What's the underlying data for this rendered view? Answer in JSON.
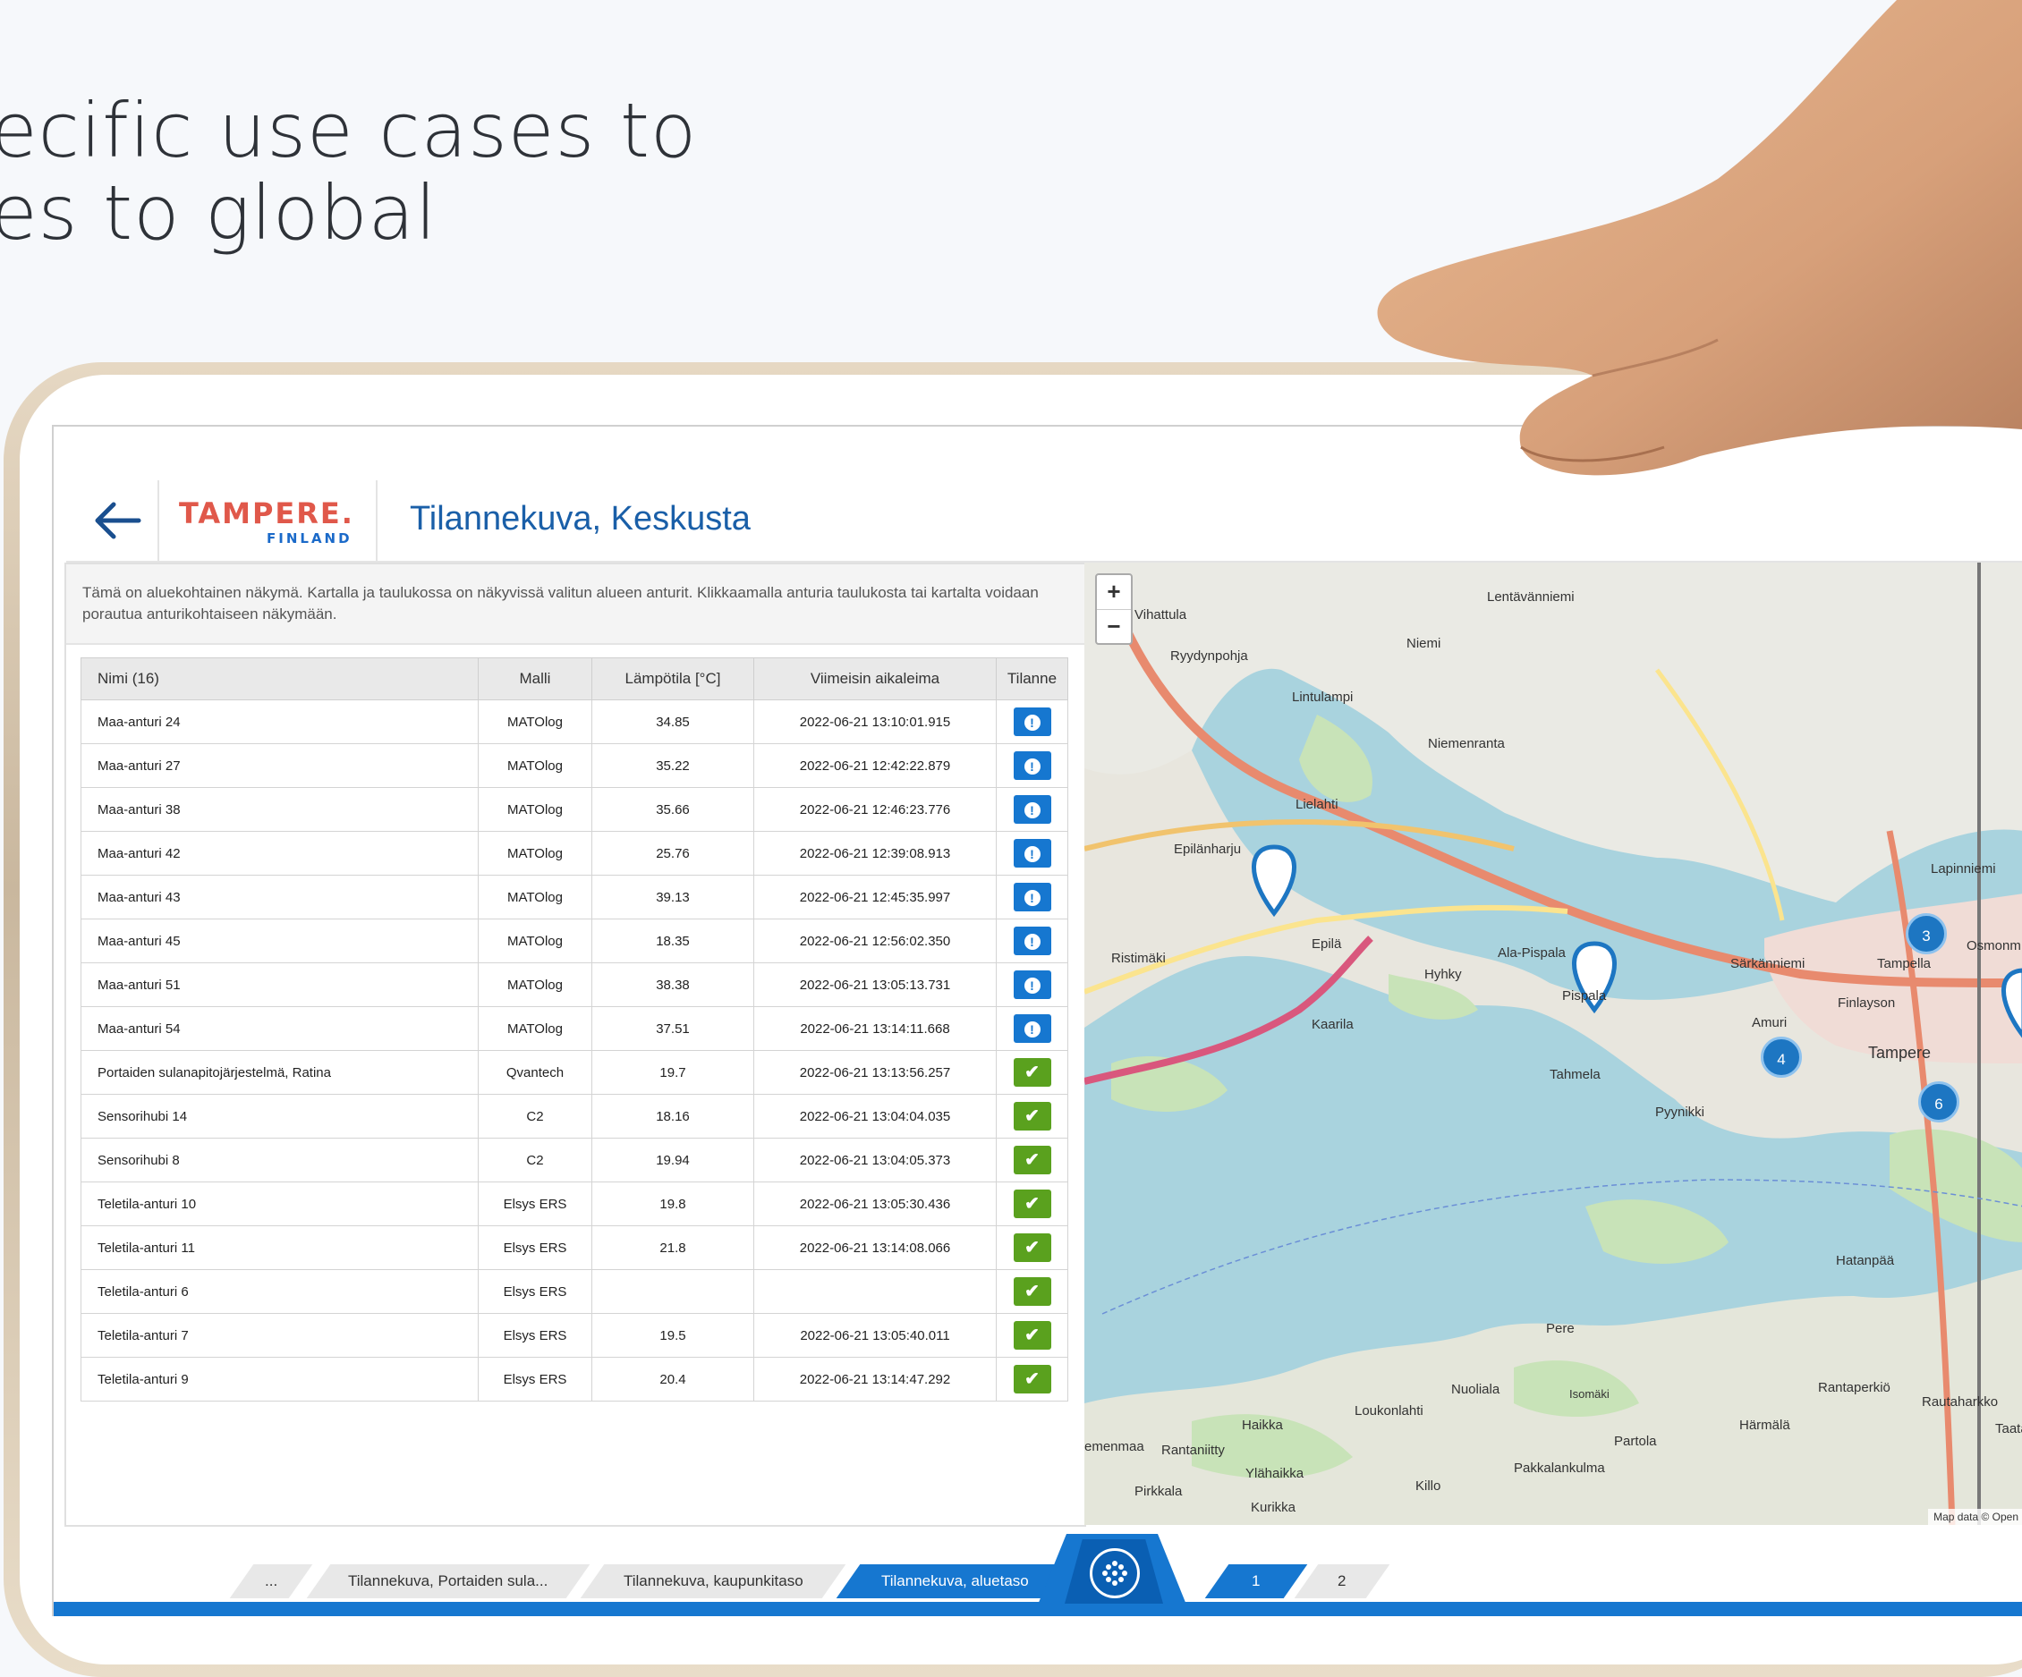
{
  "headline": {
    "line1": "ecific use cases to",
    "line2": "es to global"
  },
  "app": {
    "logo_main": "TAMPERE.",
    "logo_sub": "FINLAND",
    "title": "Tilannekuva, Keskusta",
    "description": "Tämä on aluekohtainen näkymä. Kartalla ja taulukossa on näkyvissä valitun alueen anturit. Klikkaamalla anturia taulukosta tai kartalta voidaan porautua anturikohtaiseen näkymään."
  },
  "table": {
    "headers": [
      "Nimi (16)",
      "Malli",
      "Lämpötila [°C]",
      "Viimeisin aikaleima",
      "Tilanne"
    ],
    "rows": [
      {
        "name": "Maa-anturi 24",
        "model": "MATOlog",
        "temp": "34.85",
        "time": "2022-06-21 13:10:01.915",
        "status": "warn"
      },
      {
        "name": "Maa-anturi 27",
        "model": "MATOlog",
        "temp": "35.22",
        "time": "2022-06-21 12:42:22.879",
        "status": "warn"
      },
      {
        "name": "Maa-anturi 38",
        "model": "MATOlog",
        "temp": "35.66",
        "time": "2022-06-21 12:46:23.776",
        "status": "warn"
      },
      {
        "name": "Maa-anturi 42",
        "model": "MATOlog",
        "temp": "25.76",
        "time": "2022-06-21 12:39:08.913",
        "status": "warn"
      },
      {
        "name": "Maa-anturi 43",
        "model": "MATOlog",
        "temp": "39.13",
        "time": "2022-06-21 12:45:35.997",
        "status": "warn"
      },
      {
        "name": "Maa-anturi 45",
        "model": "MATOlog",
        "temp": "18.35",
        "time": "2022-06-21 12:56:02.350",
        "status": "warn"
      },
      {
        "name": "Maa-anturi 51",
        "model": "MATOlog",
        "temp": "38.38",
        "time": "2022-06-21 13:05:13.731",
        "status": "warn"
      },
      {
        "name": "Maa-anturi 54",
        "model": "MATOlog",
        "temp": "37.51",
        "time": "2022-06-21 13:14:11.668",
        "status": "warn"
      },
      {
        "name": "Portaiden sulanapitojärjestelmä, Ratina",
        "model": "Qvantech",
        "temp": "19.7",
        "time": "2022-06-21 13:13:56.257",
        "status": "ok"
      },
      {
        "name": "Sensorihubi 14",
        "model": "C2",
        "temp": "18.16",
        "time": "2022-06-21 13:04:04.035",
        "status": "ok"
      },
      {
        "name": "Sensorihubi 8",
        "model": "C2",
        "temp": "19.94",
        "time": "2022-06-21 13:04:05.373",
        "status": "ok"
      },
      {
        "name": "Teletila-anturi 10",
        "model": "Elsys ERS",
        "temp": "19.8",
        "time": "2022-06-21 13:05:30.436",
        "status": "ok"
      },
      {
        "name": "Teletila-anturi 11",
        "model": "Elsys ERS",
        "temp": "21.8",
        "time": "2022-06-21 13:14:08.066",
        "status": "ok"
      },
      {
        "name": "Teletila-anturi 6",
        "model": "Elsys ERS",
        "temp": "",
        "time": "",
        "status": "ok"
      },
      {
        "name": "Teletila-anturi 7",
        "model": "Elsys ERS",
        "temp": "19.5",
        "time": "2022-06-21 13:05:40.011",
        "status": "ok"
      },
      {
        "name": "Teletila-anturi 9",
        "model": "Elsys ERS",
        "temp": "20.4",
        "time": "2022-06-21 13:14:47.292",
        "status": "ok"
      }
    ]
  },
  "map": {
    "zoom_in": "+",
    "zoom_out": "−",
    "places": [
      "Vihattula",
      "Lentävänniemi",
      "Ryydynpohja",
      "Niemi",
      "Lintulampi",
      "Niemenranta",
      "Lielahti",
      "Epilänharju",
      "Ristimäki",
      "Epilä",
      "Hyhky",
      "Ala-Pispala",
      "Pispala",
      "Kaarila",
      "Tahmela",
      "Pyynikki",
      "Särkänniemi",
      "Tampella",
      "Finlayson",
      "Amuri",
      "Tampere",
      "Lapinniemi",
      "Osmonm",
      "Hatanpää",
      "Pere",
      "Nuoliala",
      "Loukonlahti",
      "Haikka",
      "Rantaniitty",
      "Ylähaikka",
      "Pirkkala",
      "Killo",
      "Kurikka",
      "Pakkalankulma",
      "Partola",
      "Härmälä",
      "Rantaperkiö",
      "Rautaharkko",
      "Isomäki",
      "Taatal",
      "emenmaa"
    ],
    "clusters": [
      "3",
      "4",
      "6"
    ],
    "attribution": "Map data © Open"
  },
  "breadcrumbs": {
    "items": [
      "...",
      "Tilannekuva, Portaiden sula...",
      "Tilannekuva, kaupunkitaso",
      "Tilannekuva, aluetaso"
    ],
    "pages": [
      "1",
      "2"
    ]
  },
  "colors": {
    "accent": "#1677d0",
    "ok": "#5aa11e",
    "logo_red": "#e0584a"
  }
}
